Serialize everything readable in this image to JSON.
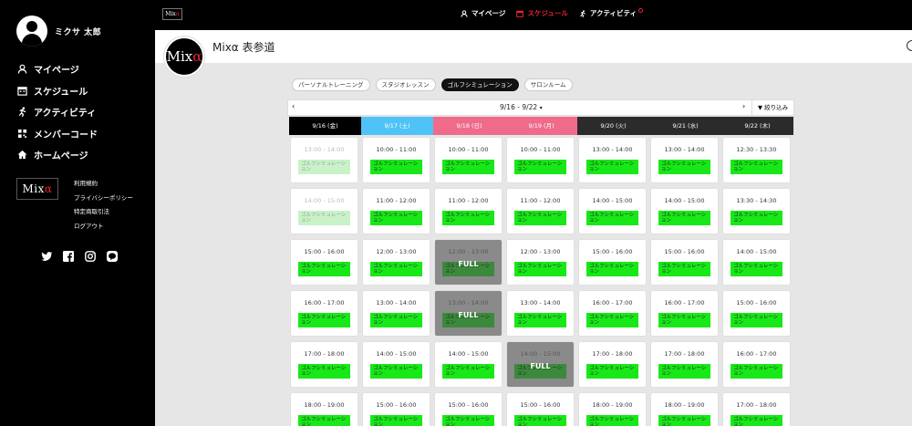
{
  "user": {
    "name": "ミクサ 太郎"
  },
  "sidebar": {
    "nav": [
      {
        "label": "マイページ",
        "icon": "user-icon"
      },
      {
        "label": "スケジュール",
        "icon": "calendar-icon"
      },
      {
        "label": "アクティビティ",
        "icon": "running-icon"
      },
      {
        "label": "メンバーコード",
        "icon": "qrcode-icon"
      },
      {
        "label": "ホームページ",
        "icon": "home-icon"
      }
    ],
    "logo_text": "Mixα",
    "links": [
      "利用規約",
      "プライバシーポリシー",
      "特定商取引法",
      "ログアウト"
    ],
    "social": [
      "twitter-icon",
      "facebook-icon",
      "instagram-icon",
      "line-icon"
    ]
  },
  "topbar": {
    "logo": "Mixα",
    "nav": [
      {
        "label": "マイページ",
        "icon": "user-icon"
      },
      {
        "label": "スケジュール",
        "icon": "calendar-icon",
        "active": true
      },
      {
        "label": "アクティビティ",
        "icon": "running-icon"
      }
    ]
  },
  "header": {
    "store_name": "Mixα 表参道",
    "logo_text": "Mixα"
  },
  "tabs": [
    {
      "label": "パーソナルトレーニング"
    },
    {
      "label": "スタジオレッスン"
    },
    {
      "label": "ゴルフシミュレーション",
      "active": true
    },
    {
      "label": "サロンルーム"
    }
  ],
  "week": {
    "range": "9/16 - 9/22",
    "prev": "‹",
    "next": "›",
    "filter": "絞り込み"
  },
  "colors": {
    "sat": "#4fc3f7",
    "holiday": "#f06a8a",
    "today": "#000000",
    "weekday": "#2b2b2b",
    "slot_green": "#18e818",
    "full": "#8a8a8a"
  },
  "days": [
    {
      "label": "9/16 (金)",
      "color": "#000000"
    },
    {
      "label": "9/17 (土)",
      "color": "#4fc3f7"
    },
    {
      "label": "9/18 (日)",
      "color": "#f06a8a"
    },
    {
      "label": "9/19 (月)",
      "color": "#f06a8a"
    },
    {
      "label": "9/20 (火)",
      "color": "#2b2b2b"
    },
    {
      "label": "9/21 (水)",
      "color": "#2b2b2b"
    },
    {
      "label": "9/22 (木)",
      "color": "#2b2b2b"
    }
  ],
  "slot_label": "ゴルフシミュレーション",
  "full_label": "FULL",
  "rows": [
    [
      {
        "time": "13:00 - 14:00",
        "state": "past"
      },
      {
        "time": "10:00 - 11:00"
      },
      {
        "time": "10:00 - 11:00"
      },
      {
        "time": "10:00 - 11:00"
      },
      {
        "time": "13:00 - 14:00"
      },
      {
        "time": "13:00 - 14:00"
      },
      {
        "time": "12:30 - 13:30"
      }
    ],
    [
      {
        "time": "14:00 - 15:00",
        "state": "past"
      },
      {
        "time": "11:00 - 12:00"
      },
      {
        "time": "11:00 - 12:00"
      },
      {
        "time": "11:00 - 12:00"
      },
      {
        "time": "14:00 - 15:00"
      },
      {
        "time": "14:00 - 15:00"
      },
      {
        "time": "13:30 - 14:30"
      }
    ],
    [
      {
        "time": "15:00 - 16:00"
      },
      {
        "time": "12:00 - 13:00"
      },
      {
        "time": "12:00 - 13:00",
        "state": "full"
      },
      {
        "time": "12:00 - 13:00"
      },
      {
        "time": "15:00 - 16:00"
      },
      {
        "time": "15:00 - 16:00"
      },
      {
        "time": "14:00 - 15:00"
      }
    ],
    [
      {
        "time": "16:00 - 17:00"
      },
      {
        "time": "13:00 - 14:00"
      },
      {
        "time": "13:00 - 14:00",
        "state": "full"
      },
      {
        "time": "13:00 - 14:00"
      },
      {
        "time": "16:00 - 17:00"
      },
      {
        "time": "16:00 - 17:00"
      },
      {
        "time": "15:00 - 16:00"
      }
    ],
    [
      {
        "time": "17:00 - 18:00"
      },
      {
        "time": "14:00 - 15:00"
      },
      {
        "time": "14:00 - 15:00"
      },
      {
        "time": "14:00 - 15:00",
        "state": "full"
      },
      {
        "time": "17:00 - 18:00"
      },
      {
        "time": "17:00 - 18:00"
      },
      {
        "time": "16:00 - 17:00"
      }
    ],
    [
      {
        "time": "18:00 - 19:00"
      },
      {
        "time": "15:00 - 16:00"
      },
      {
        "time": "15:00 - 16:00"
      },
      {
        "time": "15:00 - 16:00"
      },
      {
        "time": "18:00 - 19:00"
      },
      {
        "time": "18:00 - 19:00"
      },
      {
        "time": "17:00 - 18:00"
      }
    ]
  ]
}
